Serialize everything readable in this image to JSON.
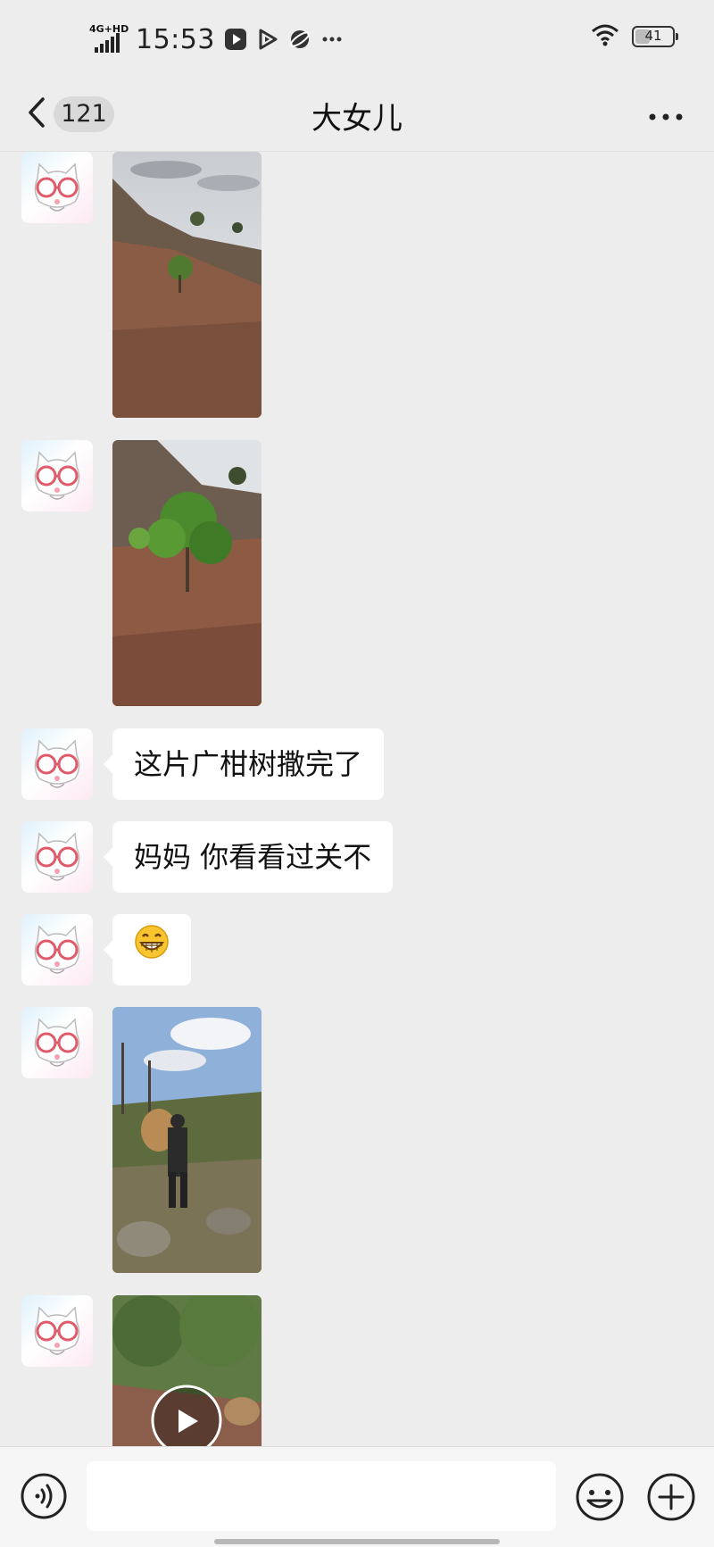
{
  "status_bar": {
    "network_label": "4G+HD",
    "time": "15:53",
    "battery_level": "41",
    "battery_fraction": 0.41,
    "icons": [
      "video-app-icon",
      "play-app-icon",
      "orbit-app-icon",
      "more-notifications-icon",
      "wifi-icon",
      "battery-icon"
    ]
  },
  "nav": {
    "back_count": "121",
    "title": "大女儿",
    "more_icon": "more-dots-icon"
  },
  "messages": [
    {
      "type": "image",
      "scene": "terraced hillside with young tree under cloudy sky"
    },
    {
      "type": "image",
      "scene": "leafy citrus sapling on red soil slope"
    },
    {
      "type": "text",
      "text": "这片广柑树撒完了"
    },
    {
      "type": "text",
      "text": "妈妈 你看看过关不"
    },
    {
      "type": "emoji",
      "emoji": "😁"
    },
    {
      "type": "image",
      "scene": "person carrying woven basket up rocky path"
    },
    {
      "type": "video",
      "scene": "orchard path with basket"
    }
  ],
  "input_bar": {
    "voice_icon": "voice-input-icon",
    "input_value": "",
    "emoji_icon": "emoji-icon",
    "plus_icon": "plus-icon"
  },
  "colors": {
    "chat_background": "#ededed",
    "bubble": "#ffffff",
    "badge": "#d9d9d9"
  }
}
